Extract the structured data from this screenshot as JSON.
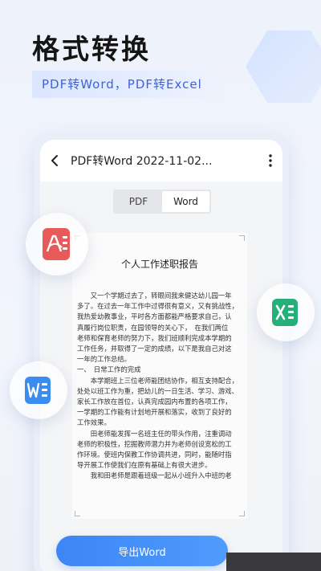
{
  "header": {
    "title": "格式转换",
    "subtitle": "PDF转Word，PDF转Excel"
  },
  "appbar": {
    "title": "PDF转Word 2022-11-02..."
  },
  "segmented": {
    "options": [
      "PDF",
      "Word"
    ],
    "selected": "Word"
  },
  "document": {
    "title": "个人工作述职报告",
    "lines": [
      "　　又一个学期过去了，转眼间我来健达幼儿园一年",
      "多了。在过去一年工作中过得很有意义，又有挑战性，",
      "我热爱幼教事业，平时各方面都能严格要求自己，认",
      "真履行岗位职责，在园领导的关心下，　在我们两位",
      "老师和保育老师的努力下，我们班顺利完成本学期的",
      "工作任务，并取得了一定的成绩，以下是我自己对这",
      "一年的工作总结。",
      "一、　日常工作的完成",
      "　　本学期班上三位老师能团结协作，相互支持配合，",
      "处处以班工作为重，把幼儿的一日生活、学习、游戏、",
      "家长工作放在首位，认真完成园内布置的各项工作，",
      "一学期的工作能有计划地开展和落实，收到了良好的",
      "工作效果。",
      "　　田老师能发挥一名班主任的带头作用，注重调动",
      "老师的积极性，挖掘教师潜力并为老师创设宽松的工",
      "作环境。使班内保教工作协调共进，同时，能随时指",
      "导开展工作使我们在原有基础上有很大进步。",
      "　　我和田老师是跟着班级一起从小班升入中班的老"
    ]
  },
  "actions": {
    "export_label": "导出Word"
  },
  "icons": {
    "back": "chevron-left-icon",
    "more": "more-vertical-icon",
    "pdf": "pdf-file-icon",
    "excel": "excel-file-icon",
    "word": "word-file-icon"
  },
  "colors": {
    "accent": "#3c86f5",
    "pdf": "#e85a5a",
    "excel": "#25b07a",
    "word": "#3a8cf0"
  }
}
